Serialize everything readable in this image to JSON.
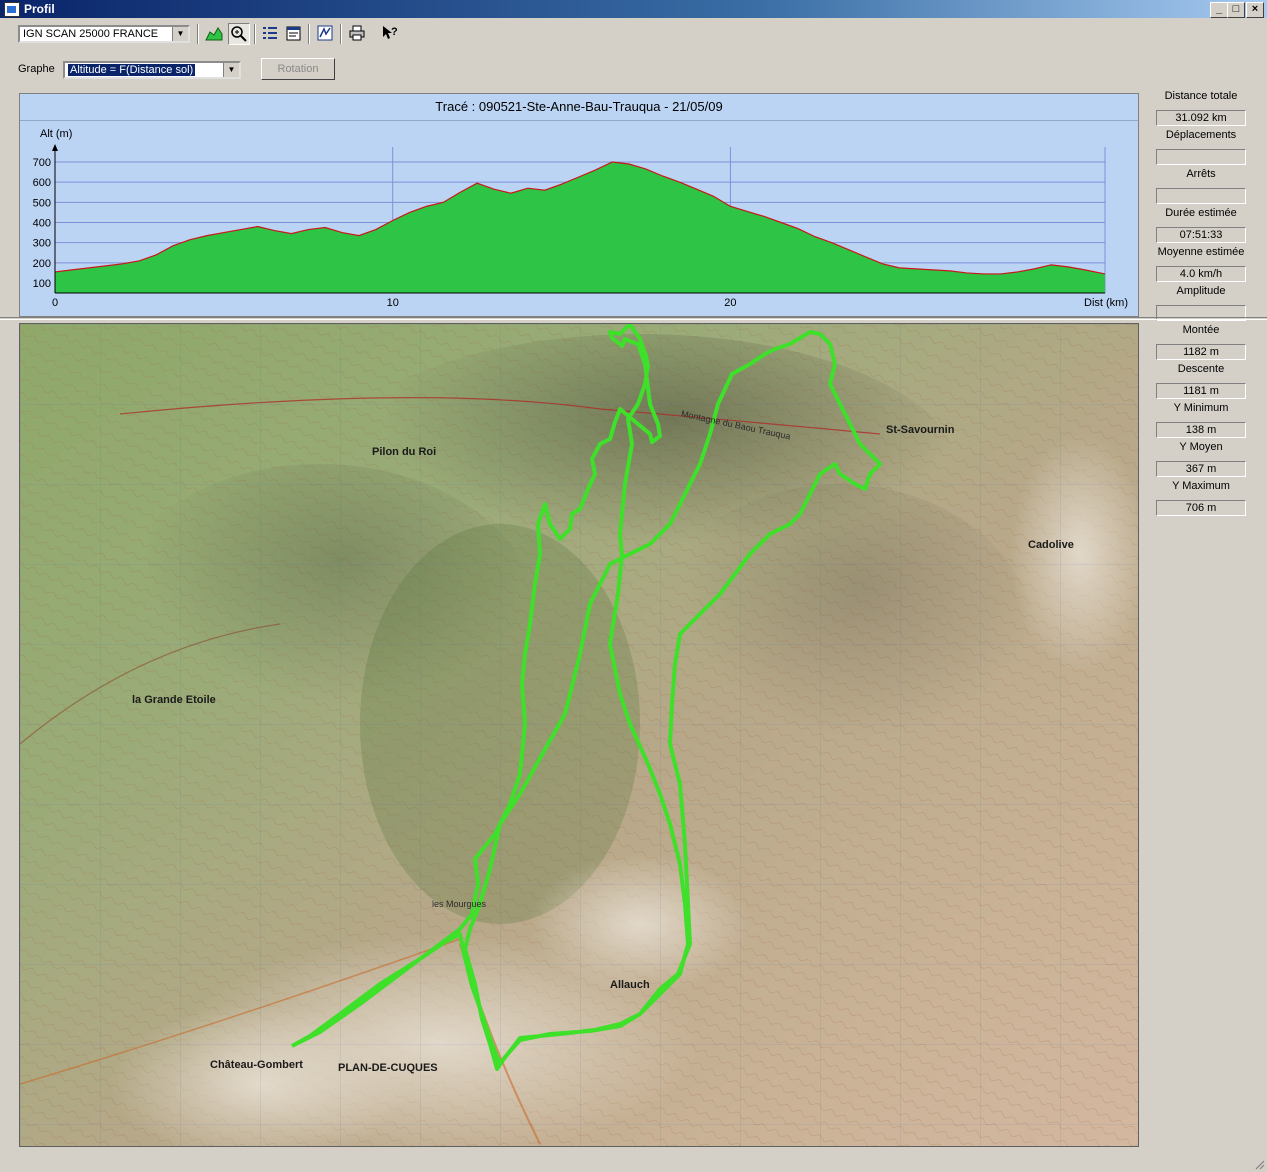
{
  "window": {
    "title": "Profil",
    "minimize_label": "_",
    "maximize_label": "□",
    "close_label": "×"
  },
  "toolbar": {
    "map_source": "IGN SCAN 25000 FRANCE",
    "buttons": [
      "profile-icon",
      "zoom-icon",
      "list-icon",
      "properties-icon",
      "curve-icon",
      "print-icon",
      "help-icon"
    ]
  },
  "graph_controls": {
    "label": "Graphe",
    "selected": "Altitude = F(Distance sol)",
    "rotation_label": "Rotation"
  },
  "chart_data": {
    "type": "area",
    "title": "Tracé : 090521-Ste-Anne-Bau-Trauqua - 21/05/09",
    "ylabel": "Alt (m)",
    "xlabel": "Dist (km)",
    "xlim": [
      0,
      31.092
    ],
    "ylim": [
      100,
      700
    ],
    "x_ticks": [
      "0",
      "10",
      "20"
    ],
    "y_ticks": [
      "100",
      "200",
      "300",
      "400",
      "500",
      "600",
      "700"
    ],
    "fill_color": "#2ec445",
    "line_color": "#c81818",
    "background": "#bcd4f4",
    "grid": true,
    "x": [
      0,
      0.5,
      1,
      1.5,
      2,
      2.5,
      3,
      3.5,
      4,
      4.5,
      5,
      5.5,
      6,
      6.5,
      7,
      7.5,
      8,
      8.5,
      9,
      9.5,
      10,
      10.5,
      11,
      11.5,
      12,
      12.5,
      13,
      13.5,
      14,
      14.5,
      15,
      15.5,
      16,
      16.5,
      17,
      17.5,
      18,
      18.5,
      19,
      19.5,
      20,
      20.5,
      21,
      21.5,
      22,
      22.5,
      23,
      23.5,
      24,
      24.5,
      25,
      25.5,
      26,
      26.5,
      27,
      27.5,
      28,
      28.5,
      29,
      29.5,
      30,
      30.5,
      31.092
    ],
    "y": [
      155,
      165,
      175,
      185,
      195,
      210,
      240,
      285,
      315,
      335,
      350,
      365,
      380,
      360,
      345,
      365,
      375,
      350,
      335,
      365,
      410,
      450,
      480,
      500,
      550,
      595,
      565,
      545,
      570,
      560,
      590,
      625,
      660,
      700,
      690,
      665,
      630,
      600,
      565,
      530,
      480,
      455,
      430,
      400,
      370,
      330,
      300,
      265,
      230,
      195,
      175,
      170,
      165,
      160,
      150,
      145,
      145,
      155,
      170,
      190,
      180,
      165,
      145
    ]
  },
  "stats": [
    {
      "label": "Distance totale",
      "value": "31.092 km"
    },
    {
      "label": "Déplacements",
      "value": ""
    },
    {
      "label": "Arrêts",
      "value": ""
    },
    {
      "label": "Durée estimée",
      "value": "07:51:33"
    },
    {
      "label": "Moyenne estimée",
      "value": "4.0 km/h"
    },
    {
      "label": "Amplitude",
      "value": ""
    },
    {
      "label": "Montée",
      "value": "1182 m"
    },
    {
      "label": "Descente",
      "value": "1181 m"
    },
    {
      "label": "Y Minimum",
      "value": "138 m"
    },
    {
      "label": "Y Moyen",
      "value": "367 m"
    },
    {
      "label": "Y Maximum",
      "value": "706 m"
    }
  ],
  "map": {
    "track_color": "#3ee02a",
    "labels": [
      "St-Savournin",
      "Cadolive",
      "Pilon du Roi",
      "la Grande Etoile",
      "Montagne du Baou Trauqua",
      "PLAN-DE-CUQUES",
      "Allauch",
      "Château-Gombert",
      "les Mourgues"
    ]
  }
}
